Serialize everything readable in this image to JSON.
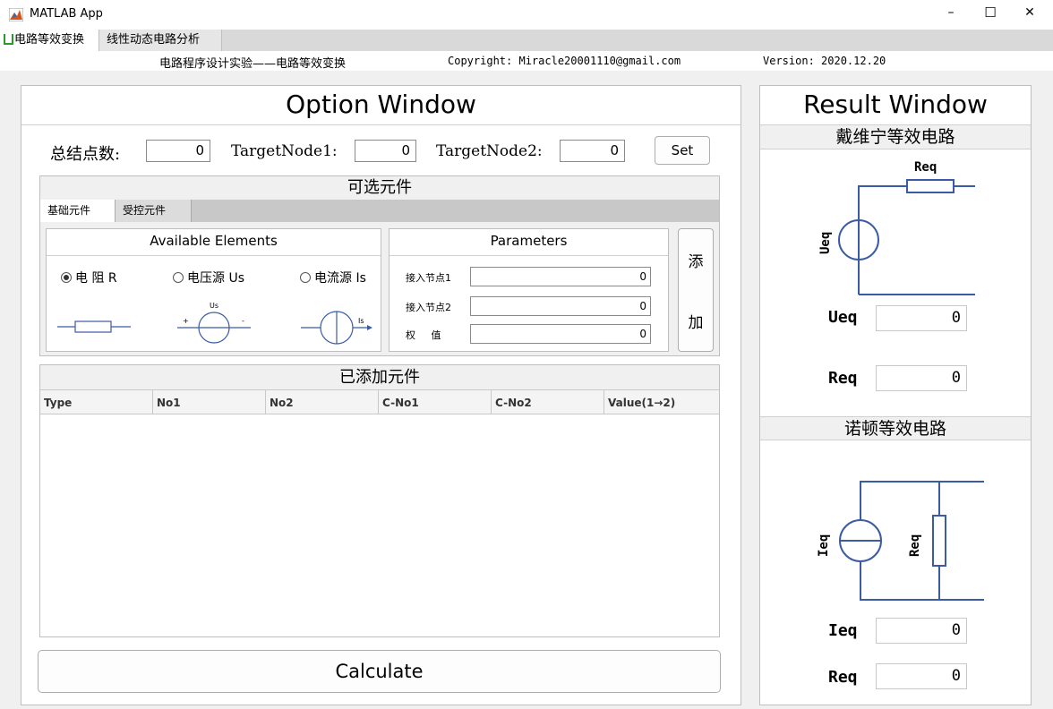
{
  "window": {
    "title": "MATLAB App",
    "minimize": "–",
    "maximize": "☐",
    "close": "✕"
  },
  "tabs": [
    "电路等效变换",
    "线性动态电路分析"
  ],
  "info": {
    "title": "电路程序设计实验——电路等效变换",
    "copyright": "Copyright: Miracle20001110@gmail.com",
    "version": "Version: 2020.12.20"
  },
  "option": {
    "title": "Option Window",
    "total_nodes_label": "总结点数:",
    "total_nodes_value": "0",
    "target1_label": "TargetNode1:",
    "target1_value": "0",
    "target2_label": "TargetNode2:",
    "target2_value": "0",
    "set_button": "Set",
    "optional_title": "可选元件",
    "subtabs": [
      "基础元件",
      "受控元件"
    ],
    "available_title": "Available Elements",
    "elements": [
      {
        "label": "电 阻  R",
        "selected": true
      },
      {
        "label": "电压源 Us",
        "selected": false
      },
      {
        "label": "电流源 Is",
        "selected": false
      }
    ],
    "us_label": "Us",
    "plus": "+",
    "minus": "-",
    "is_label": "Is",
    "params_title": "Parameters",
    "params": [
      {
        "label": "接入节点1",
        "value": "0"
      },
      {
        "label": "接入节点2",
        "value": "0"
      },
      {
        "label": "权     值",
        "value": "0"
      }
    ],
    "add_button_top": "添",
    "add_button_bottom": "加",
    "added_title": "已添加元件",
    "columns": [
      "Type",
      "No1",
      "No2",
      "C-No1",
      "C-No2",
      "Value(1→2)"
    ],
    "calculate_button": "Calculate"
  },
  "result": {
    "title": "Result Window",
    "thevenin_title": "戴维宁等效电路",
    "thevenin_req_label": "Req",
    "thevenin_ueq_label": "Ueq",
    "ueq_label": "Ueq",
    "ueq_value": "0",
    "req_label": "Req",
    "req_value": "0",
    "norton_title": "诺顿等效电路",
    "norton_ieq_label": "Ieq",
    "norton_req_label": "Req",
    "ieq_label": "Ieq",
    "ieq_value": "0",
    "req2_label": "Req",
    "req2_value": "0"
  },
  "colors": {
    "circuit": "#3b5ba5",
    "accent": "#d95319"
  }
}
